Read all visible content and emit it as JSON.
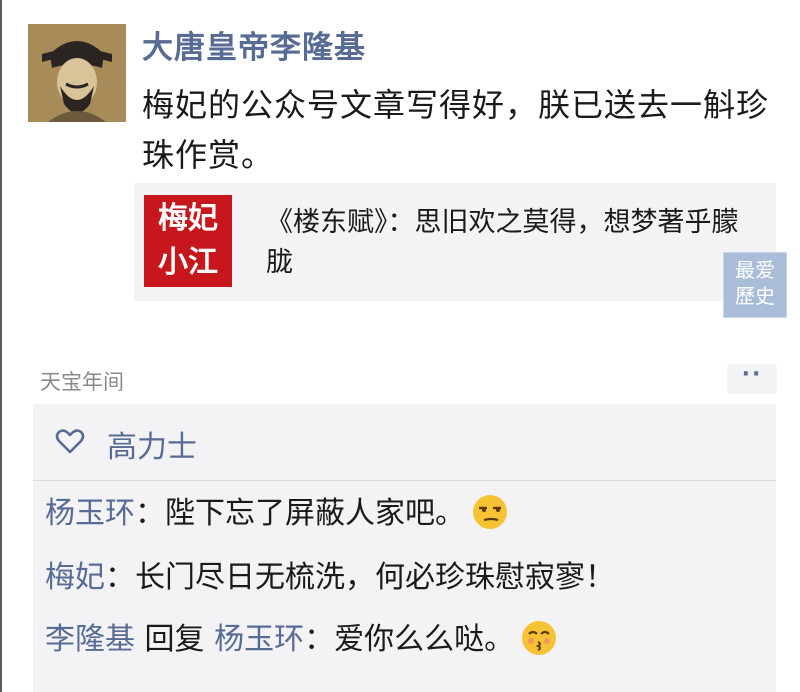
{
  "post": {
    "author": "大唐皇帝李隆基",
    "text": "梅妃的公众号文章写得好，朕已送去一斛珍珠作赏。",
    "link_card": {
      "thumb_line1": "梅妃",
      "thumb_line2": "小江",
      "title": "《楼东赋》：思旧欢之莫得，想梦著乎朦胧"
    },
    "watermark": {
      "line1": "最爱",
      "line2": "歷史"
    },
    "timestamp": "天宝年间",
    "more_label": "··"
  },
  "likes": {
    "names": "高力士"
  },
  "comments": [
    {
      "name": "杨玉环",
      "sep": "：",
      "text": "陛下忘了屏蔽人家吧。",
      "emoji": "smirk-emoji"
    },
    {
      "name": "梅妃",
      "sep": "：",
      "text": "长门尽日无梳洗，何必珍珠慰寂寥！"
    },
    {
      "name": "李隆基",
      "reply_word": "回复",
      "reply_to": "杨玉环",
      "sep": "：",
      "text": "爱你么么哒。",
      "emoji": "kiss-emoji"
    }
  ],
  "colors": {
    "name_blue": "#576b95",
    "card_bg": "#f3f3f5",
    "thumb_red": "#c8161d"
  }
}
